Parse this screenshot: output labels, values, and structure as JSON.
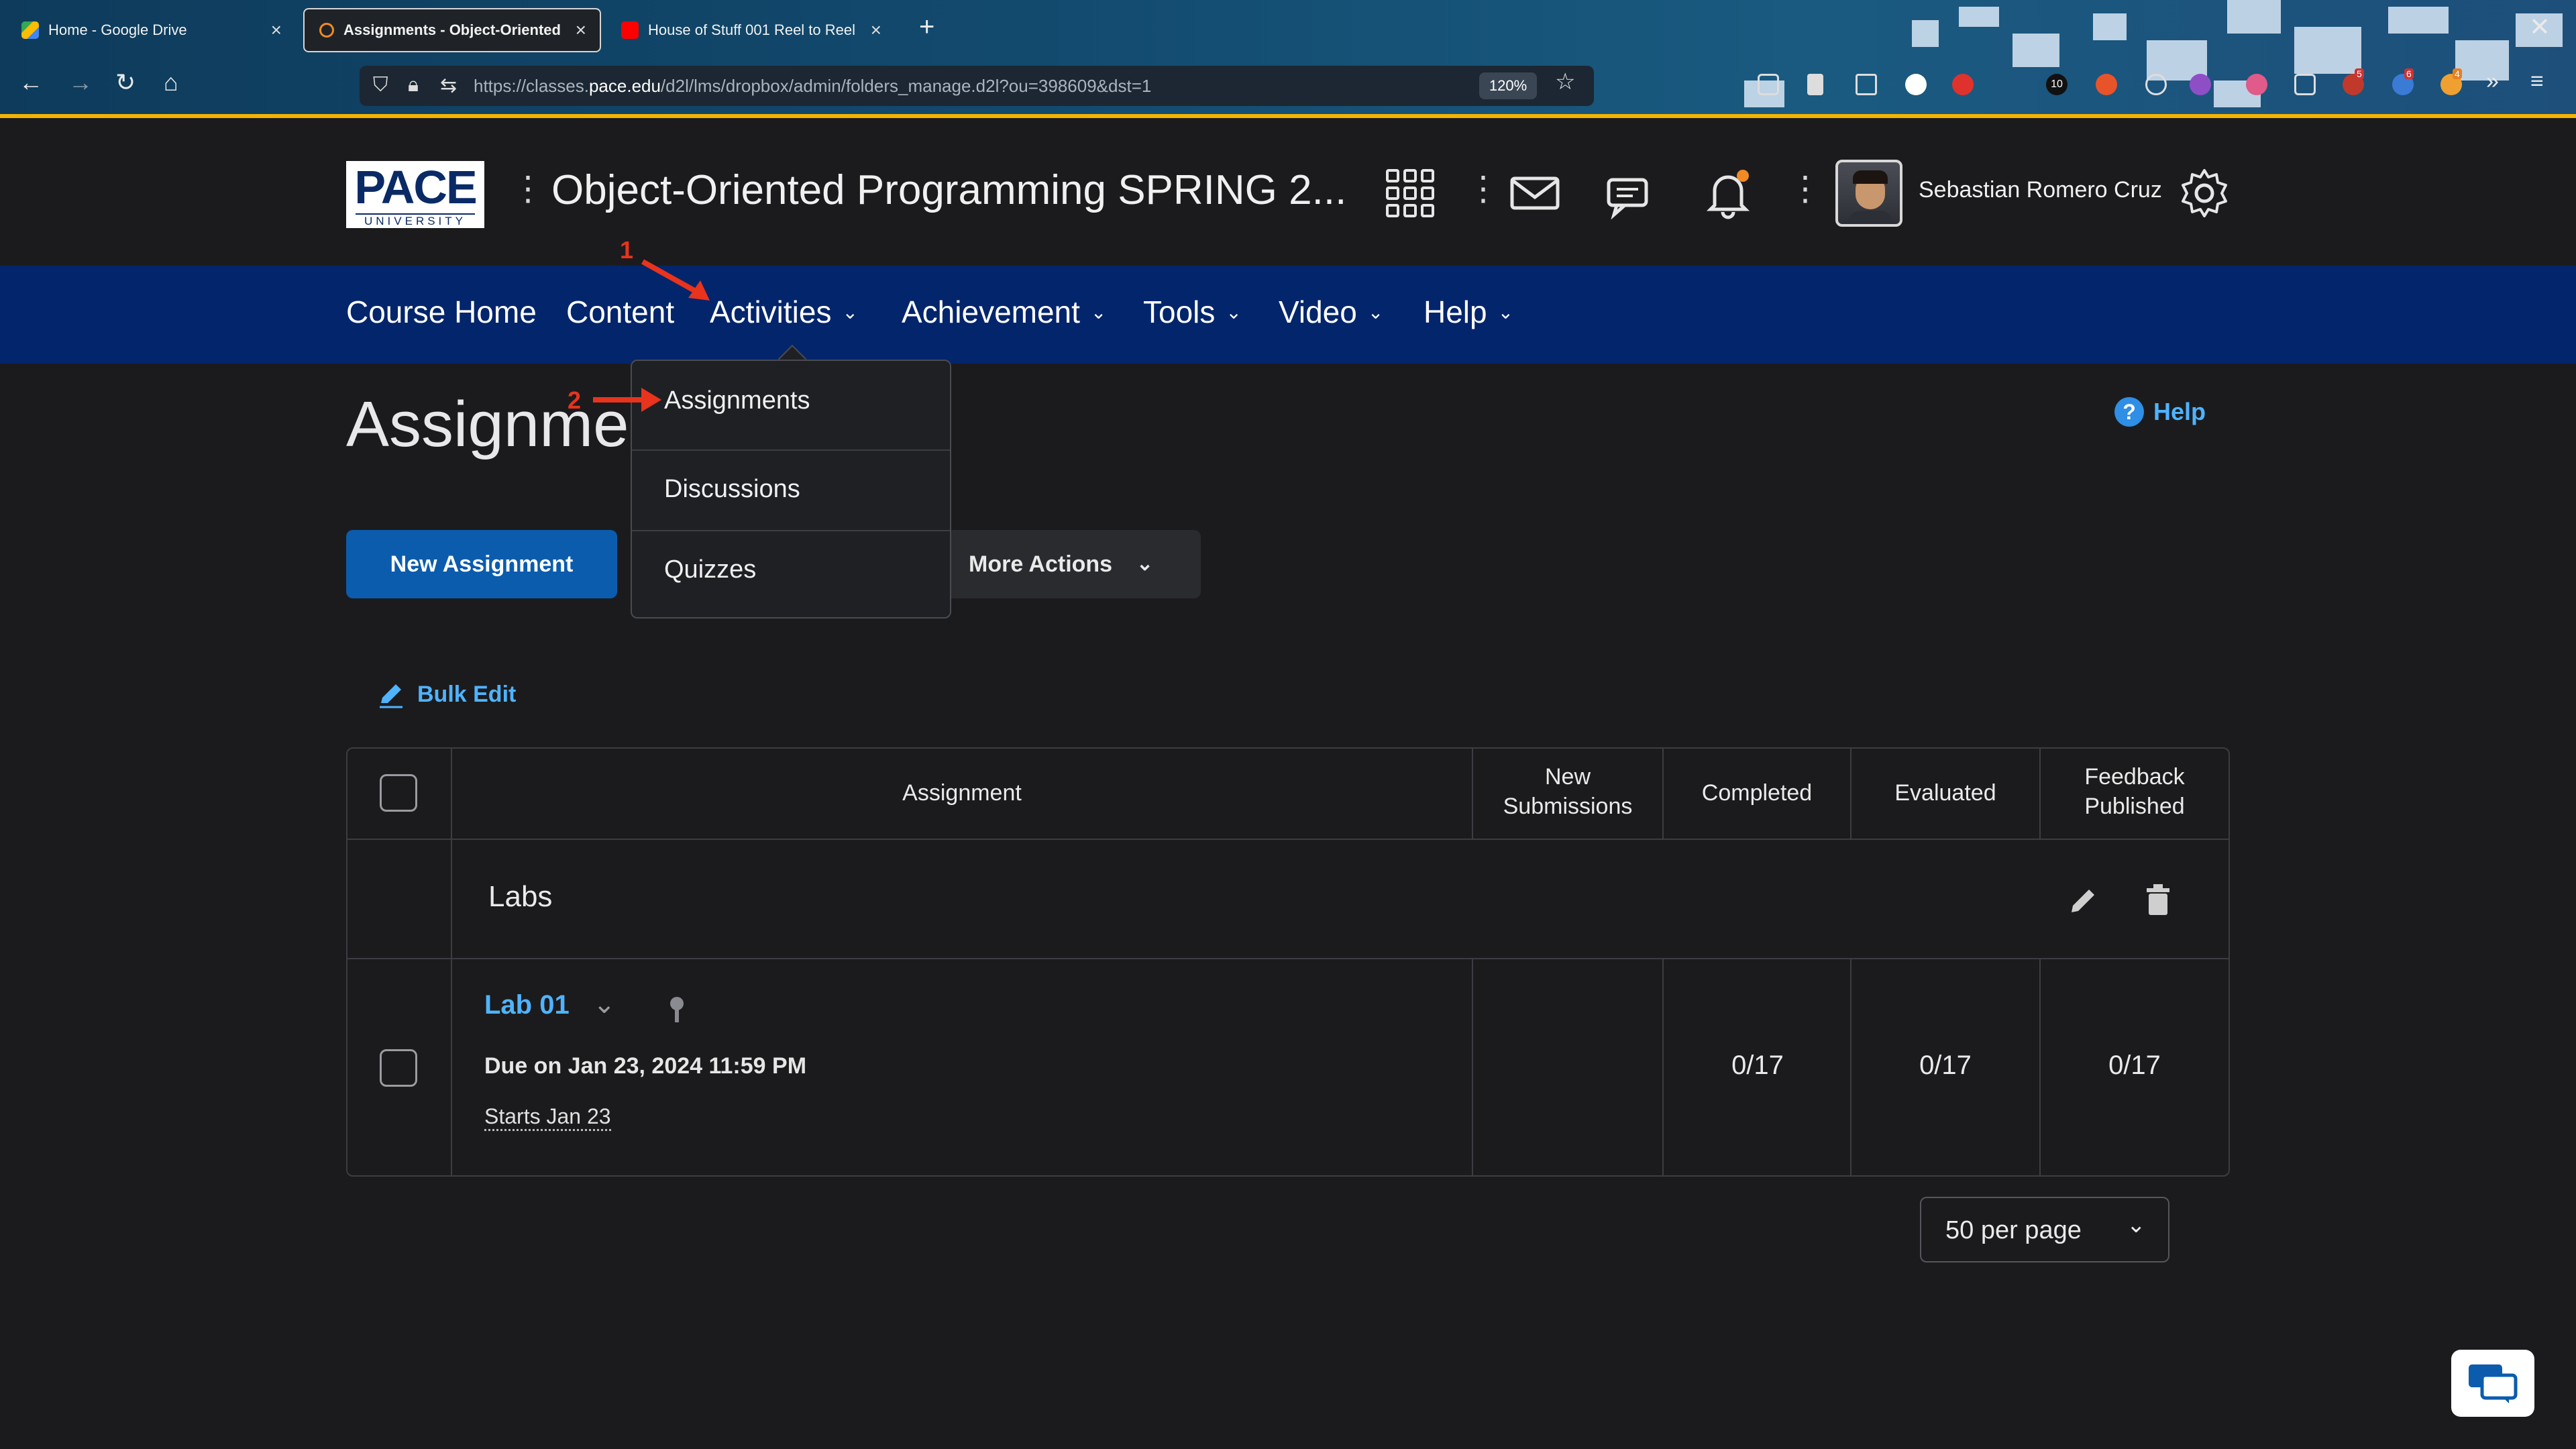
{
  "browser": {
    "tabs": [
      {
        "label": "Home - Google Drive"
      },
      {
        "label": "Assignments - Object-Oriented"
      },
      {
        "label": "House of Stuff 001 Reel to Reel"
      }
    ],
    "url_prefix": "https://classes.",
    "url_domain": "pace.edu",
    "url_rest": "/d2l/lms/dropbox/admin/folders_manage.d2l?ou=398609&dst=1",
    "zoom": "120%",
    "badges": {
      "badge_10": "10",
      "badge_5": "5",
      "badge_6": "6",
      "badge_4": "4"
    },
    "colors": {
      "gold": "#f4b400"
    }
  },
  "header": {
    "logo_main": "PACE",
    "logo_sub": "UNIVERSITY",
    "course_title": "Object-Oriented Programming SPRING 2...",
    "user_name": "Sebastian Romero Cruz"
  },
  "nav": {
    "items": [
      "Course Home",
      "Content",
      "Activities",
      "Achievement",
      "Tools",
      "Video",
      "Help"
    ]
  },
  "dropdown": {
    "items": [
      "Assignments",
      "Discussions",
      "Quizzes"
    ]
  },
  "page": {
    "title": "Assignments",
    "help_label": "Help",
    "new_assignment": "New Assignment",
    "more_actions": "More Actions",
    "bulk_edit": "Bulk Edit"
  },
  "table": {
    "headers": {
      "assignment": "Assignment",
      "new_submissions_1": "New",
      "new_submissions_2": "Submissions",
      "completed": "Completed",
      "evaluated": "Evaluated",
      "feedback_1": "Feedback",
      "feedback_2": "Published"
    },
    "group": "Labs",
    "row": {
      "name": "Lab 01",
      "due": "Due on Jan 23, 2024 11:59 PM",
      "starts": "Starts Jan 23",
      "completed": "0/17",
      "evaluated": "0/17",
      "feedback": "0/17"
    }
  },
  "pagination": {
    "per_page": "50 per page"
  },
  "annotations": {
    "one": "1",
    "two": "2"
  }
}
